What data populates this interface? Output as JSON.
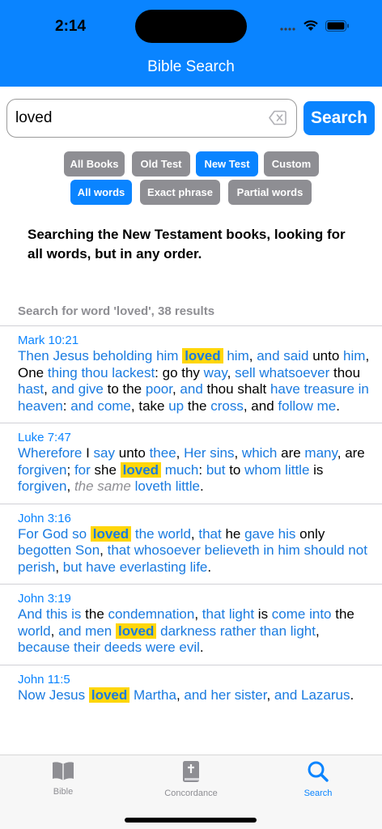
{
  "status": {
    "time": "2:14"
  },
  "nav": {
    "title": "Bible Search"
  },
  "search": {
    "value": "loved",
    "button_label": "Search"
  },
  "scope_filters": [
    {
      "label": "All Books",
      "selected": false
    },
    {
      "label": "Old Test",
      "selected": false
    },
    {
      "label": "New Test",
      "selected": true
    },
    {
      "label": "Custom",
      "selected": false
    }
  ],
  "mode_filters": [
    {
      "label": "All words",
      "selected": true
    },
    {
      "label": "Exact phrase",
      "selected": false
    },
    {
      "label": "Partial words",
      "selected": false
    }
  ],
  "info_text": "Searching the New Testament books, looking for all words, but in any order.",
  "results_header": "Search for word 'loved', 38 results",
  "results": [
    {
      "reference": "Mark 10:21",
      "segments": [
        [
          "b",
          "Then Jesus beholding him"
        ],
        [
          "t",
          " "
        ],
        [
          "h",
          "loved"
        ],
        [
          "t",
          " "
        ],
        [
          "b",
          "him"
        ],
        [
          "t",
          ", "
        ],
        [
          "b",
          "and said"
        ],
        [
          "t",
          " unto "
        ],
        [
          "b",
          "him"
        ],
        [
          "t",
          ", One "
        ],
        [
          "b",
          "thing thou lackest"
        ],
        [
          "t",
          ": go thy "
        ],
        [
          "b",
          "way"
        ],
        [
          "t",
          ", "
        ],
        [
          "b",
          "sell"
        ],
        [
          "t",
          " "
        ],
        [
          "b",
          "whatsoever"
        ],
        [
          "t",
          " thou "
        ],
        [
          "b",
          "hast"
        ],
        [
          "t",
          ", "
        ],
        [
          "b",
          "and give"
        ],
        [
          "t",
          " to the "
        ],
        [
          "b",
          "poor"
        ],
        [
          "t",
          ", "
        ],
        [
          "b",
          "and"
        ],
        [
          "t",
          " thou shalt "
        ],
        [
          "b",
          "have treasure in heaven"
        ],
        [
          "t",
          ": "
        ],
        [
          "b",
          "and come"
        ],
        [
          "t",
          ", take "
        ],
        [
          "b",
          "up"
        ],
        [
          "t",
          " the "
        ],
        [
          "b",
          "cross"
        ],
        [
          "t",
          ", and "
        ],
        [
          "b",
          "follow me"
        ],
        [
          "t",
          "."
        ]
      ]
    },
    {
      "reference": "Luke 7:47",
      "segments": [
        [
          "b",
          "Wherefore"
        ],
        [
          "t",
          " I "
        ],
        [
          "b",
          "say"
        ],
        [
          "t",
          " unto "
        ],
        [
          "b",
          "thee"
        ],
        [
          "t",
          ", "
        ],
        [
          "b",
          "Her sins"
        ],
        [
          "t",
          ", "
        ],
        [
          "b",
          "which"
        ],
        [
          "t",
          " are "
        ],
        [
          "b",
          "many"
        ],
        [
          "t",
          ", "
        ],
        [
          "t",
          "are "
        ],
        [
          "b",
          "forgiven"
        ],
        [
          "t",
          "; "
        ],
        [
          "b",
          "for"
        ],
        [
          "t",
          " she"
        ],
        [
          "t",
          " "
        ],
        [
          "h",
          "loved"
        ],
        [
          "t",
          " "
        ],
        [
          "b",
          "much"
        ],
        [
          "t",
          ": "
        ],
        [
          "b",
          "but"
        ],
        [
          "t",
          " to "
        ],
        [
          "b",
          "whom little"
        ],
        [
          "t",
          " is "
        ],
        [
          "b",
          "forgiven"
        ],
        [
          "t",
          ", "
        ],
        [
          "i",
          "the same"
        ],
        [
          "t",
          " "
        ],
        [
          "b",
          "loveth little"
        ],
        [
          "t",
          "."
        ]
      ]
    },
    {
      "reference": "John 3:16",
      "segments": [
        [
          "b",
          "For God so"
        ],
        [
          "t",
          " "
        ],
        [
          "h",
          "loved"
        ],
        [
          "t",
          " "
        ],
        [
          "b",
          "the world"
        ],
        [
          "t",
          ", "
        ],
        [
          "b",
          "that"
        ],
        [
          "t",
          " he "
        ],
        [
          "b",
          "gave his"
        ],
        [
          "t",
          " only "
        ],
        [
          "b",
          "begotten Son"
        ],
        [
          "t",
          ", "
        ],
        [
          "b",
          "that whosoever believeth in him should not perish"
        ],
        [
          "t",
          ", "
        ],
        [
          "b",
          "but have everlasting life"
        ],
        [
          "t",
          "."
        ]
      ]
    },
    {
      "reference": "John 3:19",
      "segments": [
        [
          "b",
          "And this is"
        ],
        [
          "t",
          " the "
        ],
        [
          "b",
          "condemnation"
        ],
        [
          "t",
          ", "
        ],
        [
          "b",
          "that light"
        ],
        [
          "t",
          " is "
        ],
        [
          "b",
          "come into"
        ],
        [
          "t",
          " "
        ],
        [
          "t",
          "the "
        ],
        [
          "b",
          "world"
        ],
        [
          "t",
          ", "
        ],
        [
          "b",
          "and men"
        ],
        [
          "t",
          " "
        ],
        [
          "h",
          "loved"
        ],
        [
          "t",
          " "
        ],
        [
          "b",
          "darkness rather than light"
        ],
        [
          "t",
          ", "
        ],
        [
          "b",
          "because their deeds were evil"
        ],
        [
          "t",
          "."
        ]
      ]
    },
    {
      "reference": "John 11:5",
      "segments": [
        [
          "b",
          "Now Jesus"
        ],
        [
          "t",
          " "
        ],
        [
          "h",
          "loved"
        ],
        [
          "t",
          " "
        ],
        [
          "b",
          "Martha"
        ],
        [
          "t",
          ", "
        ],
        [
          "b",
          "and her sister"
        ],
        [
          "t",
          ", "
        ],
        [
          "b",
          "and Lazarus"
        ],
        [
          "t",
          "."
        ]
      ]
    }
  ],
  "tabs": [
    {
      "label": "Bible",
      "icon": "book-icon",
      "active": false
    },
    {
      "label": "Concordance",
      "icon": "concordance-icon",
      "active": false
    },
    {
      "label": "Search",
      "icon": "magnifier-icon",
      "active": true
    }
  ]
}
